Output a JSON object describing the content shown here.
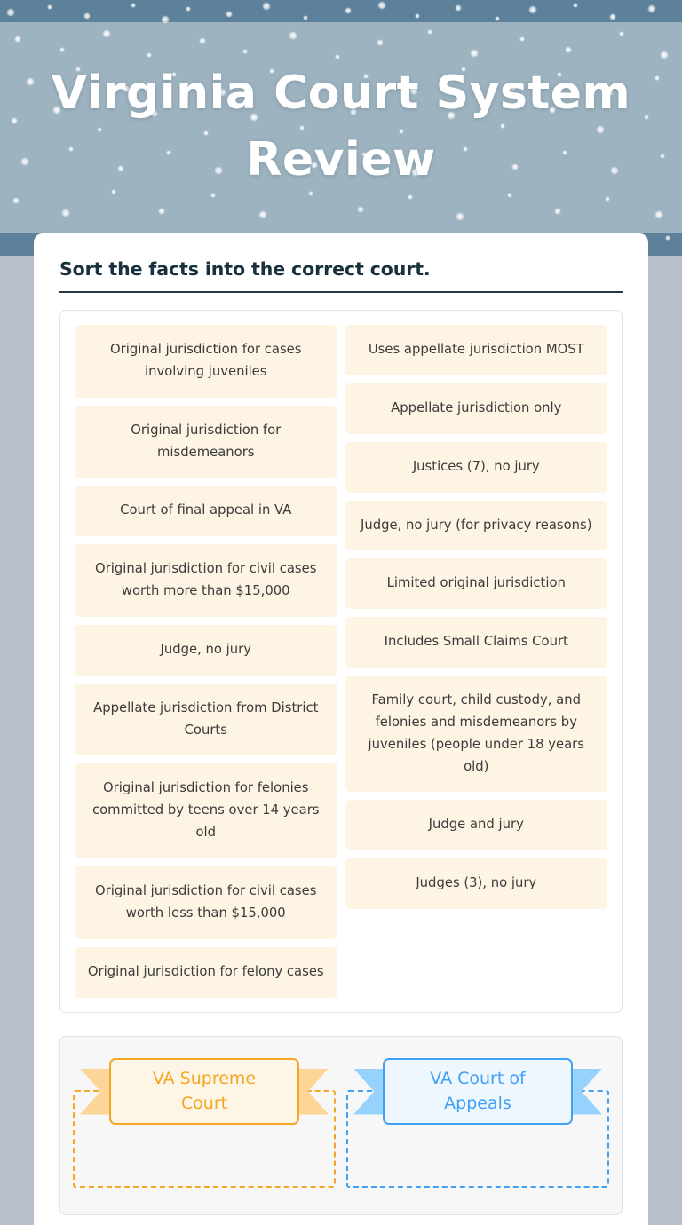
{
  "header": {
    "title": "Virginia Court System Review",
    "theme_colors": {
      "band_dark": "#5d819a",
      "band_light": "#9db3c0",
      "page_background": "#b9c0cd"
    }
  },
  "worksheet": {
    "instruction": "Sort the facts into the correct court.",
    "pool": {
      "left_column": [
        "Original jurisdiction for cases involving juveniles",
        "Original jurisdiction for misdemeanors",
        "Court of final appeal in VA",
        "Original jurisdiction for civil cases worth more than $15,000",
        "Judge, no jury",
        "Appellate jurisdiction from District Courts",
        "Original jurisdiction for felonies committed by teens over 14 years old",
        "Original jurisdiction for civil cases worth less than $15,000",
        "Original jurisdiction for felony cases"
      ],
      "right_column": [
        "Uses appellate jurisdiction MOST",
        "Appellate jurisdiction only",
        "Justices (7), no jury",
        "Judge, no jury (for privacy reasons)",
        "Limited original jurisdiction",
        "Includes Small Claims Court",
        "Family court, child custody, and felonies and misdemeanors by juveniles (people under 18 years old)",
        "Judge and jury",
        "Judges (3), no jury"
      ]
    },
    "drop_zones": [
      {
        "label": "VA Supreme Court",
        "accent": "#f5a623",
        "items": []
      },
      {
        "label": "VA Court of Appeals",
        "accent": "#3fa0f5",
        "items": []
      }
    ]
  }
}
